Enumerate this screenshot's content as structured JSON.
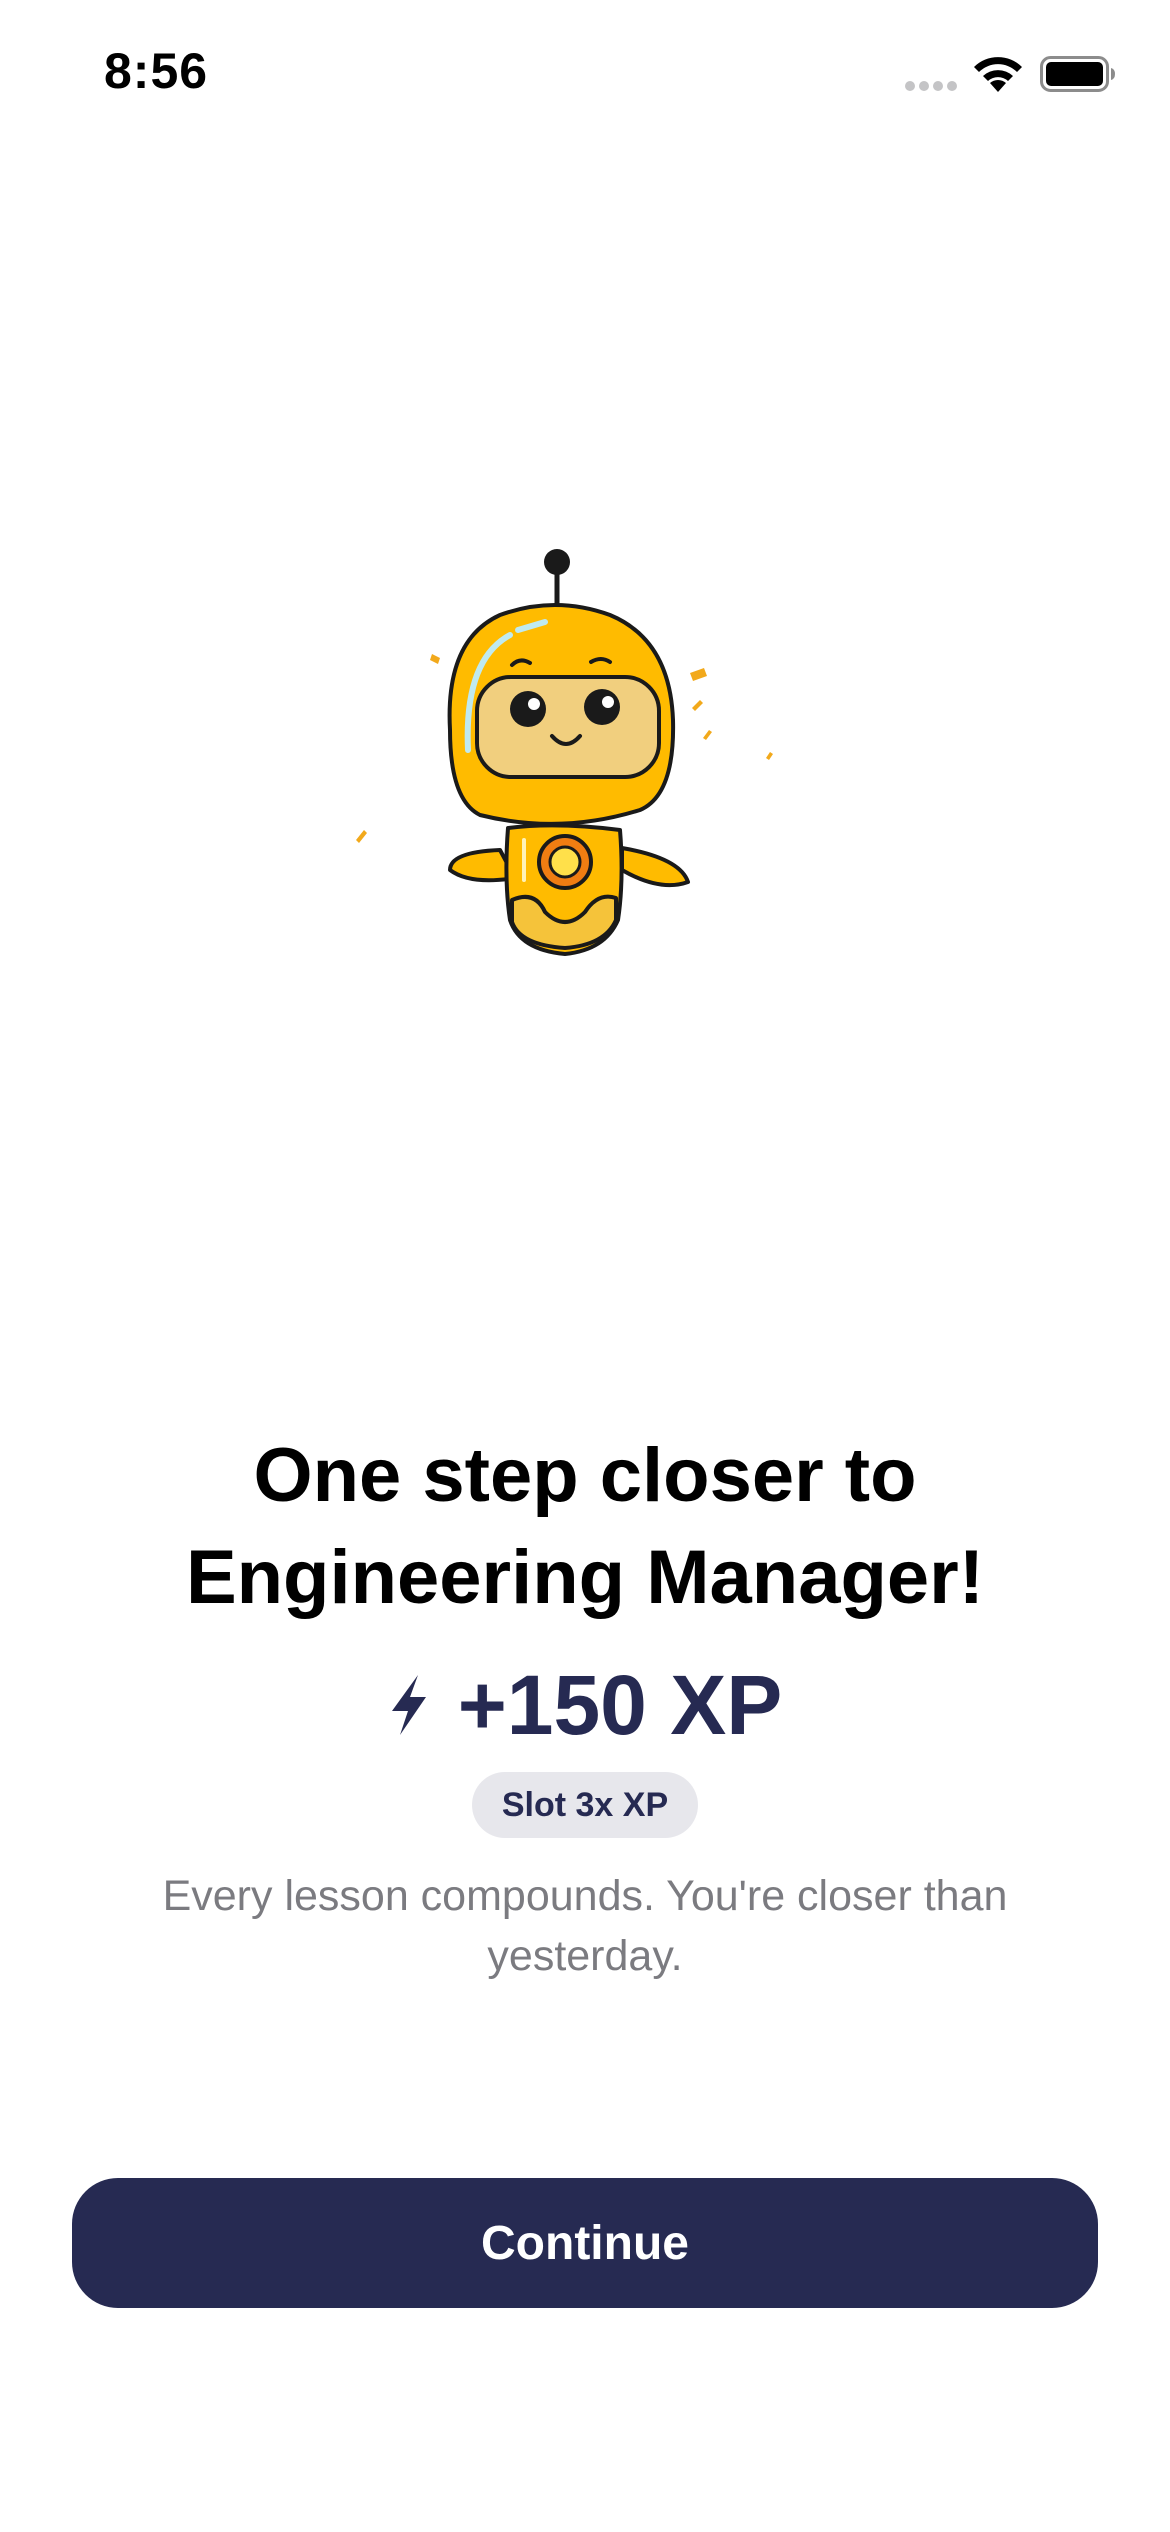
{
  "status_bar": {
    "time": "8:56",
    "icons": [
      "cellular-signal-icon",
      "wifi-icon",
      "battery-icon"
    ]
  },
  "mascot": {
    "icon": "robot-mascot-icon",
    "colors": {
      "body": "#ffbb00",
      "visor": "#f1cf7e",
      "outline": "#1a1a1a",
      "button": "#f07d12"
    }
  },
  "headline": {
    "line1": "One step closer to",
    "line2": "Engineering Manager!"
  },
  "xp": {
    "icon": "lightning-bolt-icon",
    "value": "+150 XP"
  },
  "badge": {
    "label": "Slot 3x XP"
  },
  "subtitle": {
    "text": "Every lesson compounds. You're closer than yesterday."
  },
  "continue_button": {
    "label": "Continue"
  },
  "colors": {
    "primary": "#262a52",
    "badge_bg": "#e7e7ec",
    "subtitle": "#7b7b80",
    "background": "#ffffff"
  }
}
